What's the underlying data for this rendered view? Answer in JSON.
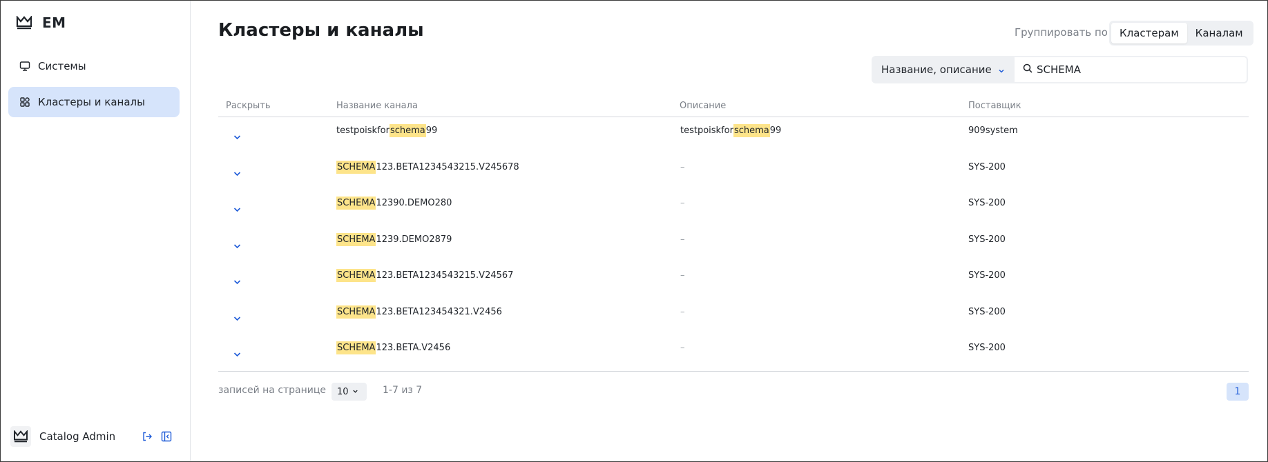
{
  "app": {
    "logo_text": "EM"
  },
  "sidebar": {
    "items": [
      {
        "label": "Системы",
        "icon": "monitor-icon",
        "active": false
      },
      {
        "label": "Кластеры и каналы",
        "icon": "grid-icon",
        "active": true
      }
    ],
    "user": {
      "name": "Catalog Admin",
      "actions": [
        "logout-icon",
        "collapse-sidebar-icon"
      ]
    }
  },
  "header": {
    "title": "Кластеры и каналы",
    "group_label": "Группировать по",
    "group_options": [
      {
        "label": "Кластерам",
        "selected": true
      },
      {
        "label": "Каналам",
        "selected": false
      }
    ]
  },
  "filter": {
    "field_select": "Название, описание",
    "search_value": "SCHEMA"
  },
  "table": {
    "columns": [
      "Раскрыть",
      "Название канала",
      "Описание",
      "Поставщик"
    ],
    "rows": [
      {
        "name": [
          "testpoiskfor",
          "schema",
          "99"
        ],
        "description": [
          "testpoiskfor",
          "schema",
          "99"
        ],
        "supplier": "909system"
      },
      {
        "name": [
          "",
          "SCHEMA",
          "123.BETA1234543215.V245678"
        ],
        "description": "–",
        "supplier": "SYS-200"
      },
      {
        "name": [
          "",
          "SCHEMA",
          "12390.DEMO280"
        ],
        "description": "–",
        "supplier": "SYS-200"
      },
      {
        "name": [
          "",
          "SCHEMA",
          "1239.DEMO2879"
        ],
        "description": "–",
        "supplier": "SYS-200"
      },
      {
        "name": [
          "",
          "SCHEMA",
          "123.BETA1234543215.V24567"
        ],
        "description": "–",
        "supplier": "SYS-200"
      },
      {
        "name": [
          "",
          "SCHEMA",
          "123.BETA123454321.V2456"
        ],
        "description": "–",
        "supplier": "SYS-200"
      },
      {
        "name": [
          "",
          "SCHEMA",
          "123.BETA.V2456"
        ],
        "description": "–",
        "supplier": "SYS-200"
      }
    ]
  },
  "pagination": {
    "per_page_label": "записей на странице",
    "per_page_value": "10",
    "range_text": "1-7 из 7",
    "current_page": "1"
  },
  "colors": {
    "accent": "#1e5bd8",
    "active_bg": "#d6e4fb",
    "highlight": "#fde48a",
    "muted_text": "#7a7f87"
  }
}
